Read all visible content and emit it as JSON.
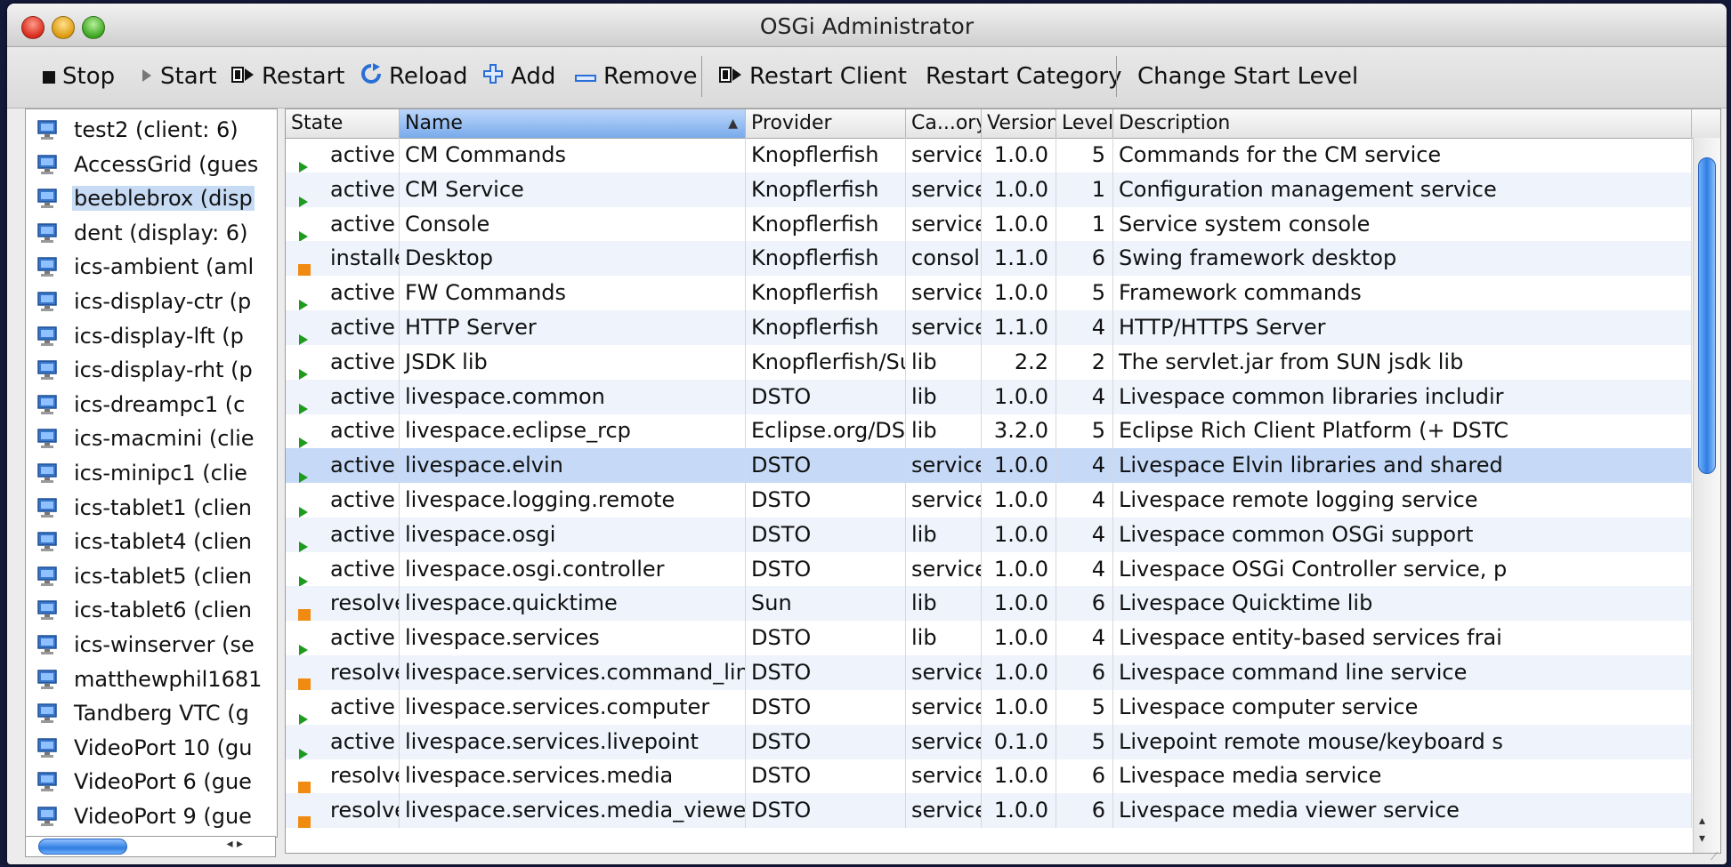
{
  "window": {
    "title": "OSGi Administrator"
  },
  "toolbar": {
    "stop_label": "Stop",
    "start_label": "Start",
    "restart_label": "Restart",
    "reload_label": "Reload",
    "add_label": "Add",
    "remove_label": "Remove",
    "restart_client_label": "Restart Client",
    "restart_category_label": "Restart Category",
    "change_start_level_label": "Change Start Level"
  },
  "clients": [
    "test2 (client: 6)",
    "AccessGrid (gues",
    "beeblebrox (disp",
    "dent (display: 6)",
    "ics-ambient (aml",
    "ics-display-ctr (p",
    "ics-display-lft (p",
    "ics-display-rht (p",
    "ics-dreampc1 (c",
    "ics-macmini (clie",
    "ics-minipc1 (clie",
    "ics-tablet1 (clien",
    "ics-tablet4 (clien",
    "ics-tablet5 (clien",
    "ics-tablet6 (clien",
    "ics-winserver (se",
    "matthewphil1681",
    "Tandberg VTC (g",
    "VideoPort 10 (gu",
    "VideoPort 6 (gue",
    "VideoPort 9 (gue"
  ],
  "selected_client_index": 2,
  "table": {
    "columns": [
      "State",
      "Name",
      "Provider",
      "Ca...ory",
      "Version",
      "Level",
      "Description"
    ],
    "sorted_column": "Name",
    "selected_row_index": 9,
    "rows": [
      {
        "state": "active",
        "name": "CM Commands",
        "provider": "Knopflerfish",
        "category": "service",
        "version": "1.0.0",
        "level": "5",
        "description": "Commands for the CM service"
      },
      {
        "state": "active",
        "name": "CM Service",
        "provider": "Knopflerfish",
        "category": "service",
        "version": "1.0.0",
        "level": "1",
        "description": "Configuration management service"
      },
      {
        "state": "active",
        "name": "Console",
        "provider": "Knopflerfish",
        "category": "service",
        "version": "1.0.0",
        "level": "1",
        "description": "Service system console"
      },
      {
        "state": "installed",
        "name": "Desktop",
        "provider": "Knopflerfish",
        "category": "console",
        "version": "1.1.0",
        "level": "6",
        "description": "Swing framework desktop"
      },
      {
        "state": "active",
        "name": "FW Commands",
        "provider": "Knopflerfish",
        "category": "service",
        "version": "1.0.0",
        "level": "5",
        "description": "Framework commands"
      },
      {
        "state": "active",
        "name": "HTTP Server",
        "provider": "Knopflerfish",
        "category": "service",
        "version": "1.1.0",
        "level": "4",
        "description": "HTTP/HTTPS Server"
      },
      {
        "state": "active",
        "name": "JSDK lib",
        "provider": "Knopflerfish/Sun",
        "category": "lib",
        "version": "2.2",
        "level": "2",
        "description": "The servlet.jar from SUN jsdk lib"
      },
      {
        "state": "active",
        "name": "livespace.common",
        "provider": "DSTO",
        "category": "lib",
        "version": "1.0.0",
        "level": "4",
        "description": "Livespace common libraries includir"
      },
      {
        "state": "active",
        "name": "livespace.eclipse_rcp",
        "provider": "Eclipse.org/DSTO",
        "category": "lib",
        "version": "3.2.0",
        "level": "5",
        "description": "Eclipse Rich Client Platform (+ DSTC"
      },
      {
        "state": "active",
        "name": "livespace.elvin",
        "provider": "DSTO",
        "category": "service",
        "version": "1.0.0",
        "level": "4",
        "description": "Livespace Elvin libraries and shared"
      },
      {
        "state": "active",
        "name": "livespace.logging.remote",
        "provider": "DSTO",
        "category": "service",
        "version": "1.0.0",
        "level": "4",
        "description": "Livespace remote logging service"
      },
      {
        "state": "active",
        "name": "livespace.osgi",
        "provider": "DSTO",
        "category": "lib",
        "version": "1.0.0",
        "level": "4",
        "description": "Livespace common OSGi support"
      },
      {
        "state": "active",
        "name": "livespace.osgi.controller",
        "provider": "DSTO",
        "category": "service",
        "version": "1.0.0",
        "level": "4",
        "description": "Livespace OSGi Controller service, p"
      },
      {
        "state": "resolved",
        "name": "livespace.quicktime",
        "provider": "Sun",
        "category": "lib",
        "version": "1.0.0",
        "level": "6",
        "description": "Livespace Quicktime lib"
      },
      {
        "state": "active",
        "name": "livespace.services",
        "provider": "DSTO",
        "category": "lib",
        "version": "1.0.0",
        "level": "4",
        "description": "Livespace entity-based services frai"
      },
      {
        "state": "resolved",
        "name": "livespace.services.command_line",
        "provider": "DSTO",
        "category": "service",
        "version": "1.0.0",
        "level": "6",
        "description": "Livespace command line service"
      },
      {
        "state": "active",
        "name": "livespace.services.computer",
        "provider": "DSTO",
        "category": "service",
        "version": "1.0.0",
        "level": "5",
        "description": "Livespace computer service"
      },
      {
        "state": "active",
        "name": "livespace.services.livepoint",
        "provider": "DSTO",
        "category": "service",
        "version": "0.1.0",
        "level": "5",
        "description": "Livepoint remote mouse/keyboard s"
      },
      {
        "state": "resolved",
        "name": "livespace.services.media",
        "provider": "DSTO",
        "category": "service",
        "version": "1.0.0",
        "level": "6",
        "description": "Livespace media service"
      },
      {
        "state": "resolved",
        "name": "livespace.services.media_viewer",
        "provider": "DSTO",
        "category": "service",
        "version": "1.0.0",
        "level": "6",
        "description": "Livespace media viewer service"
      }
    ]
  },
  "colors": {
    "active_icon": "#1e9a1e",
    "inactive_icon": "#f08a10",
    "selection": "#c6daf7",
    "alt_row": "#eef3fc"
  }
}
